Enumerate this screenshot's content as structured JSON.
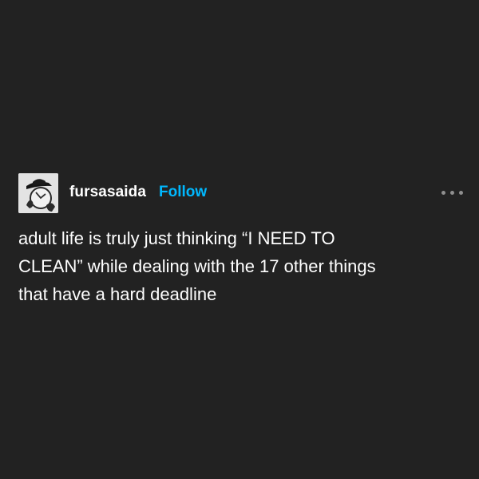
{
  "post": {
    "username": "fursasaida",
    "follow_label": "Follow",
    "avatar_icon": "avatar-photo-icon",
    "more_icon": "more-options-icon",
    "text": "adult life is truly just thinking “I NEED TO\nCLEAN” while dealing with the 17 other things\nthat have a hard deadline"
  },
  "colors": {
    "background": "#222222",
    "text": "#ffffff",
    "follow": "#00b8ff",
    "icon": "#8f8f8f"
  }
}
